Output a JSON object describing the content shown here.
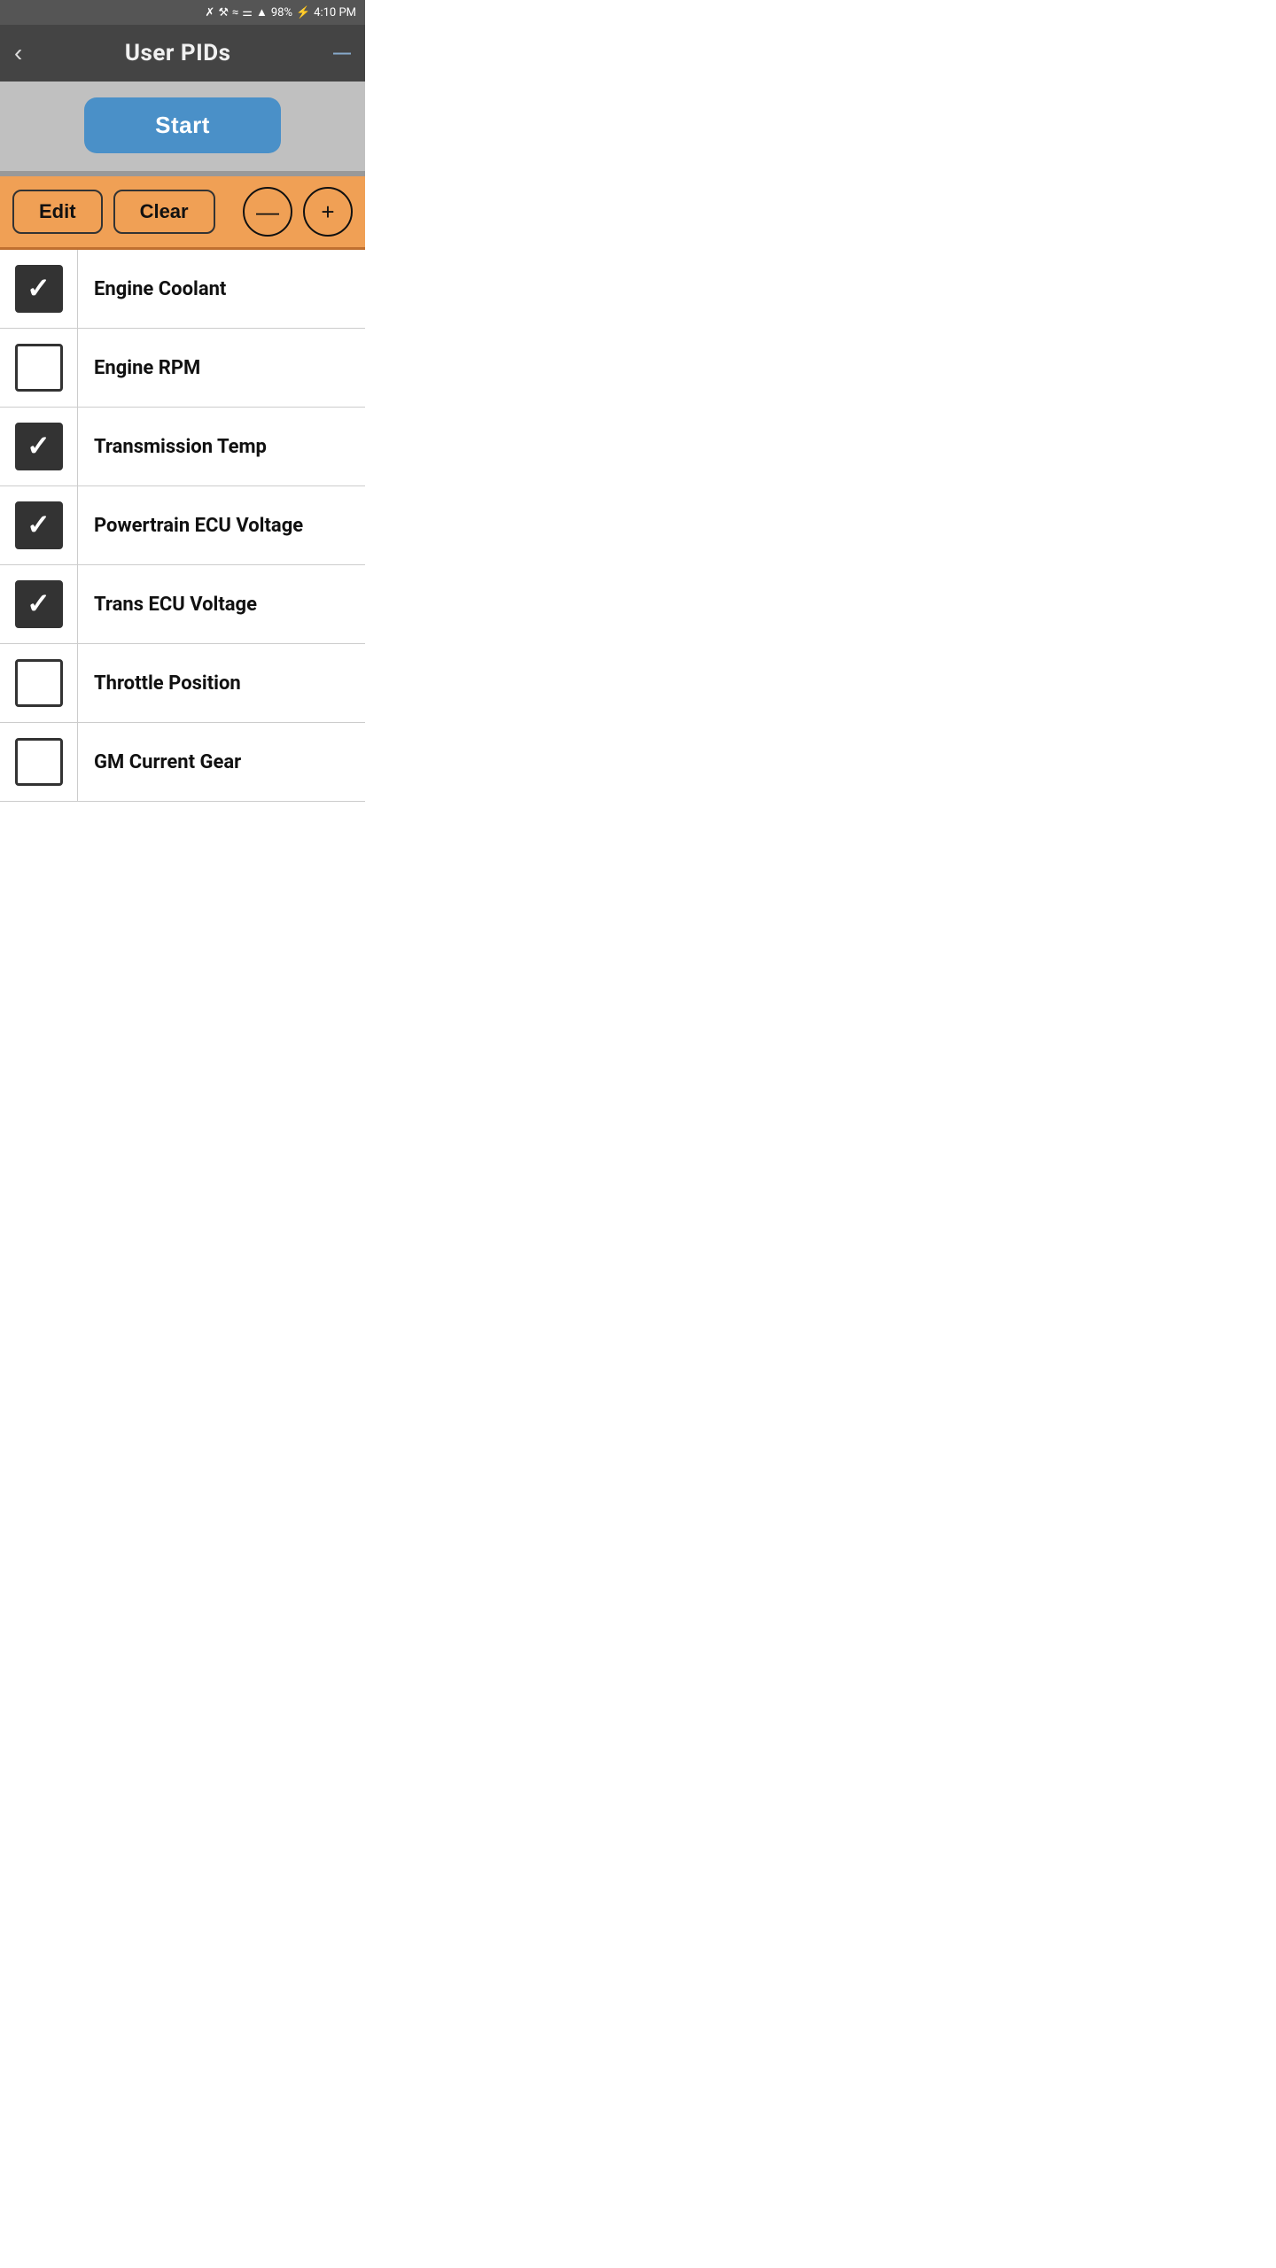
{
  "statusBar": {
    "battery": "98%",
    "time": "4:10 PM",
    "icons": [
      "bluetooth",
      "alarm",
      "wifi",
      "signal-blocked",
      "signal",
      "battery"
    ]
  },
  "navbar": {
    "back_label": "‹",
    "title": "User PIDs",
    "menu_label": "—"
  },
  "startArea": {
    "start_label": "Start"
  },
  "toolbar": {
    "edit_label": "Edit",
    "clear_label": "Clear",
    "minus_label": "—",
    "plus_label": "+"
  },
  "pidItems": [
    {
      "id": 1,
      "label": "Engine Coolant",
      "checked": true
    },
    {
      "id": 2,
      "label": "Engine RPM",
      "checked": false
    },
    {
      "id": 3,
      "label": "Transmission Temp",
      "checked": true
    },
    {
      "id": 4,
      "label": "Powertrain ECU Voltage",
      "checked": true
    },
    {
      "id": 5,
      "label": "Trans ECU Voltage",
      "checked": true
    },
    {
      "id": 6,
      "label": "Throttle Position",
      "checked": false
    },
    {
      "id": 7,
      "label": "GM Current Gear",
      "checked": false
    }
  ]
}
